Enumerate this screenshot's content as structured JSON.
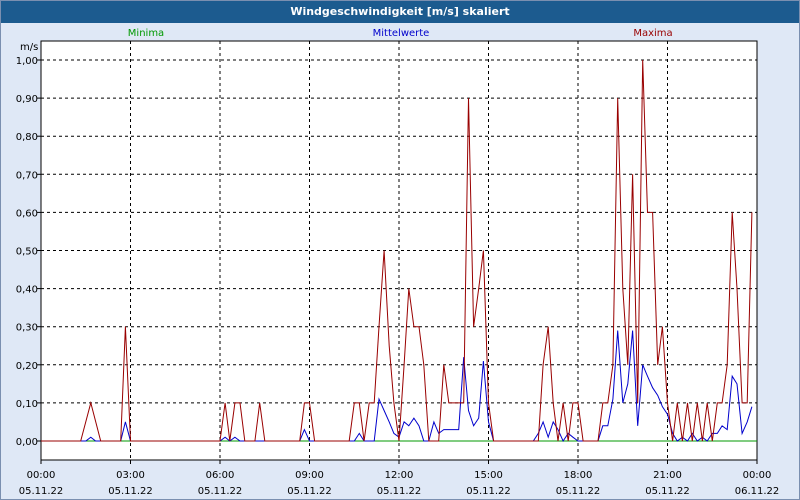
{
  "window": {
    "title": "Windgeschwindigkeit [m/s] skaliert"
  },
  "chart_data": {
    "type": "line",
    "title": "Windgeschwindigkeit [m/s] skaliert",
    "ylabel": "m/s",
    "xlabel": "",
    "ylim": [
      0,
      1.0
    ],
    "xlim_hours": [
      0,
      24
    ],
    "grid": true,
    "legend_position": "top",
    "y_ticks": [
      "0,00",
      "0,10",
      "0,20",
      "0,30",
      "0,40",
      "0,50",
      "0,60",
      "0,70",
      "0,80",
      "0,90",
      "1,00"
    ],
    "x_ticks": [
      {
        "hour": 0,
        "time": "00:00",
        "date": "05.11.22"
      },
      {
        "hour": 3,
        "time": "03:00",
        "date": "05.11.22"
      },
      {
        "hour": 6,
        "time": "06:00",
        "date": "05.11.22"
      },
      {
        "hour": 9,
        "time": "09:00",
        "date": "05.11.22"
      },
      {
        "hour": 12,
        "time": "12:00",
        "date": "05.11.22"
      },
      {
        "hour": 15,
        "time": "15:00",
        "date": "05.11.22"
      },
      {
        "hour": 18,
        "time": "18:00",
        "date": "05.11.22"
      },
      {
        "hour": 21,
        "time": "21:00",
        "date": "05.11.22"
      },
      {
        "hour": 24,
        "time": "00:00",
        "date": "06.11.22"
      }
    ],
    "series": [
      {
        "name": "Minima",
        "color": "#009900",
        "points": [
          [
            0,
            0
          ],
          [
            24,
            0
          ]
        ]
      },
      {
        "name": "Mittelwerte",
        "color": "#0000cc",
        "points": [
          [
            0,
            0
          ],
          [
            1.5,
            0
          ],
          [
            1.67,
            0.01
          ],
          [
            1.83,
            0
          ],
          [
            2.67,
            0
          ],
          [
            2.83,
            0.05
          ],
          [
            3.0,
            0
          ],
          [
            6.0,
            0
          ],
          [
            6.17,
            0.01
          ],
          [
            6.33,
            0
          ],
          [
            6.5,
            0.01
          ],
          [
            6.67,
            0
          ],
          [
            8.67,
            0
          ],
          [
            8.83,
            0.03
          ],
          [
            9.0,
            0
          ],
          [
            10.5,
            0
          ],
          [
            10.67,
            0.02
          ],
          [
            10.83,
            0
          ],
          [
            11.17,
            0
          ],
          [
            11.33,
            0.11
          ],
          [
            11.5,
            0.08
          ],
          [
            11.67,
            0.05
          ],
          [
            11.83,
            0.02
          ],
          [
            12.0,
            0.01
          ],
          [
            12.17,
            0.05
          ],
          [
            12.33,
            0.04
          ],
          [
            12.5,
            0.06
          ],
          [
            12.67,
            0.04
          ],
          [
            12.83,
            0
          ],
          [
            13.0,
            0
          ],
          [
            13.17,
            0.05
          ],
          [
            13.33,
            0.02
          ],
          [
            13.5,
            0.03
          ],
          [
            13.67,
            0.03
          ],
          [
            13.83,
            0.03
          ],
          [
            14.0,
            0.03
          ],
          [
            14.17,
            0.22
          ],
          [
            14.33,
            0.08
          ],
          [
            14.5,
            0.04
          ],
          [
            14.67,
            0.06
          ],
          [
            14.83,
            0.21
          ],
          [
            15.0,
            0.05
          ],
          [
            15.17,
            0
          ],
          [
            16.5,
            0
          ],
          [
            16.67,
            0.02
          ],
          [
            16.83,
            0.05
          ],
          [
            17.0,
            0.01
          ],
          [
            17.17,
            0.05
          ],
          [
            17.33,
            0.03
          ],
          [
            17.5,
            0
          ],
          [
            17.67,
            0.02
          ],
          [
            17.83,
            0.01
          ],
          [
            18.0,
            0
          ],
          [
            18.67,
            0
          ],
          [
            18.83,
            0.04
          ],
          [
            19.0,
            0.04
          ],
          [
            19.17,
            0.11
          ],
          [
            19.33,
            0.29
          ],
          [
            19.5,
            0.1
          ],
          [
            19.67,
            0.15
          ],
          [
            19.83,
            0.29
          ],
          [
            20.0,
            0.04
          ],
          [
            20.17,
            0.2
          ],
          [
            20.33,
            0.17
          ],
          [
            20.5,
            0.14
          ],
          [
            20.67,
            0.12
          ],
          [
            20.83,
            0.09
          ],
          [
            21.0,
            0.07
          ],
          [
            21.17,
            0.02
          ],
          [
            21.33,
            0
          ],
          [
            21.5,
            0.01
          ],
          [
            21.67,
            0
          ],
          [
            21.83,
            0.02
          ],
          [
            22.0,
            0
          ],
          [
            22.17,
            0.01
          ],
          [
            22.33,
            0
          ],
          [
            22.5,
            0.02
          ],
          [
            22.67,
            0.02
          ],
          [
            22.83,
            0.04
          ],
          [
            23.0,
            0.03
          ],
          [
            23.17,
            0.17
          ],
          [
            23.33,
            0.15
          ],
          [
            23.5,
            0.02
          ],
          [
            23.67,
            0.05
          ],
          [
            23.83,
            0.09
          ]
        ]
      },
      {
        "name": "Maxima",
        "color": "#990000",
        "points": [
          [
            0,
            0
          ],
          [
            1.33,
            0
          ],
          [
            1.67,
            0.1
          ],
          [
            2.0,
            0
          ],
          [
            2.67,
            0
          ],
          [
            2.83,
            0.3
          ],
          [
            3.0,
            0
          ],
          [
            6.0,
            0
          ],
          [
            6.17,
            0.1
          ],
          [
            6.33,
            0
          ],
          [
            6.5,
            0.1
          ],
          [
            6.67,
            0.1
          ],
          [
            6.83,
            0
          ],
          [
            7.17,
            0
          ],
          [
            7.33,
            0.1
          ],
          [
            7.5,
            0
          ],
          [
            8.67,
            0
          ],
          [
            8.83,
            0.1
          ],
          [
            9.0,
            0.1
          ],
          [
            9.17,
            0
          ],
          [
            10.33,
            0
          ],
          [
            10.5,
            0.1
          ],
          [
            10.67,
            0.1
          ],
          [
            10.83,
            0
          ],
          [
            11.0,
            0.1
          ],
          [
            11.17,
            0.1
          ],
          [
            11.33,
            0.3
          ],
          [
            11.5,
            0.5
          ],
          [
            11.67,
            0.25
          ],
          [
            11.83,
            0.1
          ],
          [
            12.0,
            0
          ],
          [
            12.17,
            0.2
          ],
          [
            12.33,
            0.4
          ],
          [
            12.5,
            0.3
          ],
          [
            12.67,
            0.3
          ],
          [
            12.83,
            0.2
          ],
          [
            13.0,
            0
          ],
          [
            13.33,
            0
          ],
          [
            13.5,
            0.2
          ],
          [
            13.67,
            0.1
          ],
          [
            14.0,
            0.1
          ],
          [
            14.17,
            0.1
          ],
          [
            14.33,
            0.9
          ],
          [
            14.5,
            0.3
          ],
          [
            14.67,
            0.4
          ],
          [
            14.83,
            0.5
          ],
          [
            15.0,
            0.1
          ],
          [
            15.17,
            0
          ],
          [
            16.67,
            0
          ],
          [
            16.83,
            0.2
          ],
          [
            17.0,
            0.3
          ],
          [
            17.17,
            0.1
          ],
          [
            17.33,
            0
          ],
          [
            17.5,
            0.1
          ],
          [
            17.67,
            0
          ],
          [
            17.83,
            0.1
          ],
          [
            18.0,
            0.1
          ],
          [
            18.17,
            0
          ],
          [
            18.67,
            0
          ],
          [
            18.83,
            0.1
          ],
          [
            19.0,
            0.1
          ],
          [
            19.17,
            0.2
          ],
          [
            19.33,
            0.9
          ],
          [
            19.5,
            0.4
          ],
          [
            19.67,
            0.2
          ],
          [
            19.83,
            0.7
          ],
          [
            20.0,
            0.1
          ],
          [
            20.17,
            1.0
          ],
          [
            20.33,
            0.6
          ],
          [
            20.5,
            0.6
          ],
          [
            20.67,
            0.2
          ],
          [
            20.83,
            0.3
          ],
          [
            21.0,
            0.1
          ],
          [
            21.17,
            0
          ],
          [
            21.33,
            0.1
          ],
          [
            21.5,
            0
          ],
          [
            21.67,
            0.1
          ],
          [
            21.83,
            0
          ],
          [
            22.0,
            0.1
          ],
          [
            22.17,
            0
          ],
          [
            22.33,
            0.1
          ],
          [
            22.5,
            0
          ],
          [
            22.67,
            0.1
          ],
          [
            22.83,
            0.1
          ],
          [
            23.0,
            0.2
          ],
          [
            23.17,
            0.6
          ],
          [
            23.33,
            0.4
          ],
          [
            23.5,
            0.1
          ],
          [
            23.67,
            0.1
          ],
          [
            23.83,
            0.6
          ]
        ]
      }
    ]
  }
}
